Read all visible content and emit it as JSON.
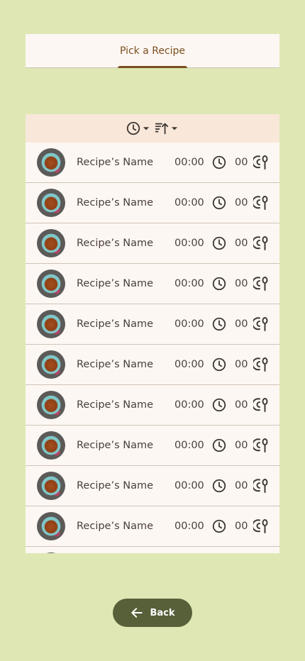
{
  "tabs": {
    "active_label": "Pick a Recipe"
  },
  "sort": {
    "time_icon": "clock-icon",
    "order_icon": "sort-icon",
    "dropdown_icon": "arrow-drop-down-icon"
  },
  "recipes": [
    {
      "name": "Recipe’s Name",
      "time": "00:00",
      "servings": "00"
    },
    {
      "name": "Recipe’s Name",
      "time": "00:00",
      "servings": "00"
    },
    {
      "name": "Recipe’s Name",
      "time": "00:00",
      "servings": "00"
    },
    {
      "name": "Recipe’s Name",
      "time": "00:00",
      "servings": "00"
    },
    {
      "name": "Recipe’s Name",
      "time": "00:00",
      "servings": "00"
    },
    {
      "name": "Recipe’s Name",
      "time": "00:00",
      "servings": "00"
    },
    {
      "name": "Recipe’s Name",
      "time": "00:00",
      "servings": "00"
    },
    {
      "name": "Recipe’s Name",
      "time": "00:00",
      "servings": "00"
    },
    {
      "name": "Recipe’s Name",
      "time": "00:00",
      "servings": "00"
    },
    {
      "name": "Recipe’s Name",
      "time": "00:00",
      "servings": "00"
    },
    {
      "name": "",
      "time": "",
      "servings": ""
    }
  ],
  "footer": {
    "back_label": "Back",
    "back_icon": "arrow-back-icon"
  },
  "colors": {
    "background": "#dfe8b4",
    "accent": "#7a4f1f",
    "button": "#576039",
    "surface": "#fdf7f3",
    "sort_bar": "#f9e7d9"
  }
}
